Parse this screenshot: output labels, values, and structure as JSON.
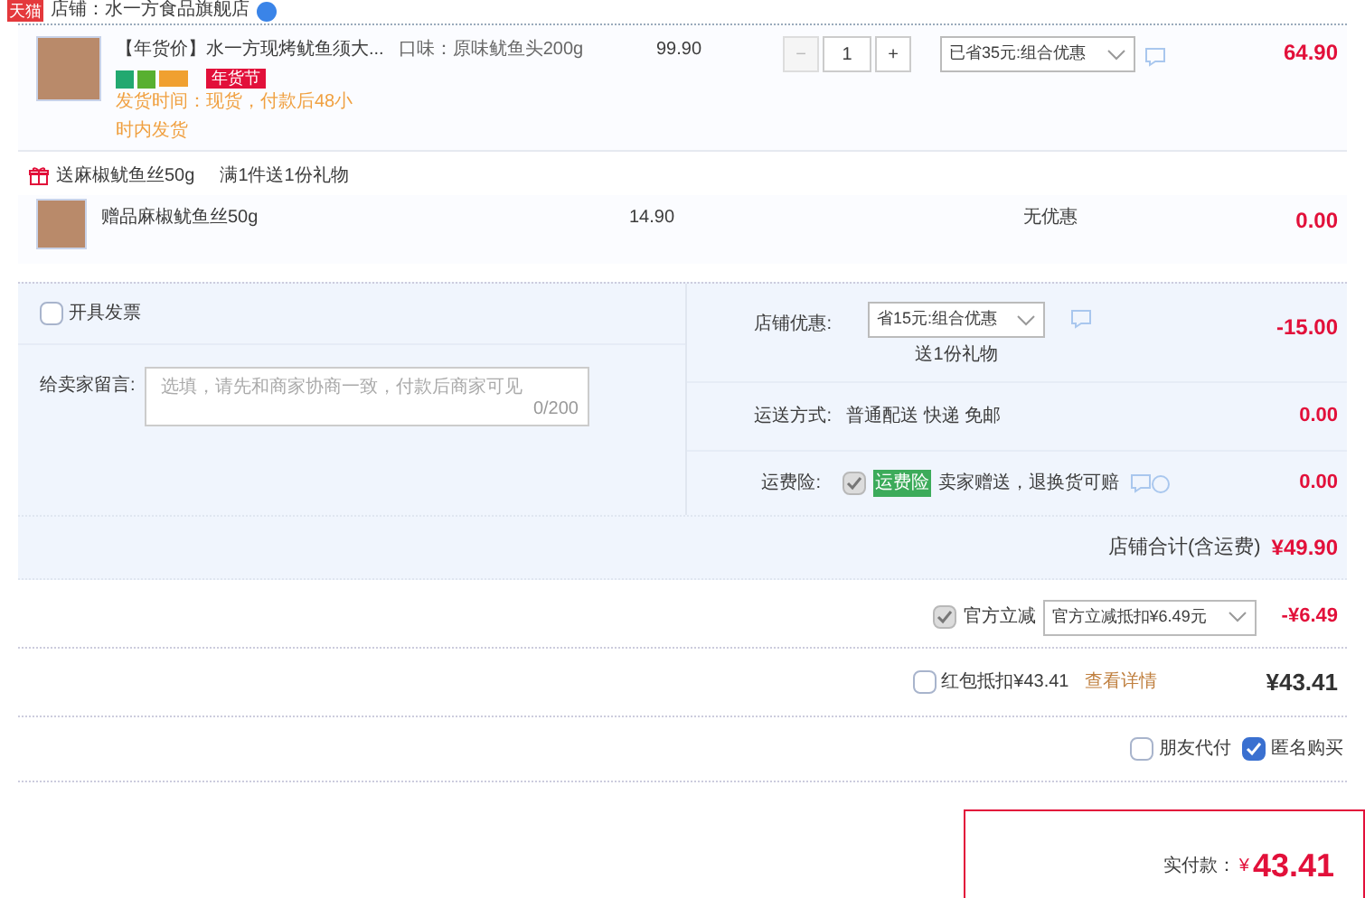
{
  "shop": {
    "badge": "天猫",
    "name": "店铺：水一方食品旗舰店"
  },
  "product": {
    "title": "【年货价】水一方现烤鱿鱼须大...",
    "spec": "口味：原味鱿鱼头200g",
    "tag": "年货节",
    "shipping_note": "发货时间：现货，付款后48小时内发货",
    "price": "99.90",
    "quantity": "1",
    "minus": "−",
    "plus": "+",
    "discount": "已省35元:组合优惠",
    "total": "64.90"
  },
  "gift": {
    "header": "送麻椒鱿鱼丝50g",
    "rule": "满1件送1份礼物",
    "title": "赠品麻椒鱿鱼丝50g",
    "price": "14.90",
    "discount": "无优惠",
    "total": "0.00"
  },
  "invoice": {
    "label": "开具发票",
    "checked": false
  },
  "message": {
    "label": "给卖家留言:",
    "placeholder": "选填，请先和商家协商一致，付款后商家可见",
    "counter": "0/200"
  },
  "shop_discount": {
    "label": "店铺优惠:",
    "value": "省15元:组合优惠",
    "note": "送1份礼物",
    "amount": "-15.00"
  },
  "delivery": {
    "label": "运送方式:",
    "value": "普通配送 快递 免邮",
    "amount": "0.00"
  },
  "insurance": {
    "label": "运费险:",
    "checked": true,
    "badge": "运费险",
    "text": "卖家赠送，退换货可赔",
    "amount": "0.00"
  },
  "shop_total": {
    "label": "店铺合计(含运费)",
    "amount": "¥49.90"
  },
  "official_discount": {
    "label": "官方立减",
    "checked": true,
    "value": "官方立减抵扣¥6.49元",
    "amount": "-¥6.49"
  },
  "red_packet": {
    "label": "红包抵扣¥43.41",
    "checked": false,
    "link": "查看详情",
    "amount": "¥43.41"
  },
  "options": [
    {
      "label": "朋友代付",
      "checked": false
    },
    {
      "label": "匿名购买",
      "checked": true
    }
  ],
  "pay": {
    "label": "实付款：",
    "currency": "¥",
    "amount": "43.41"
  }
}
